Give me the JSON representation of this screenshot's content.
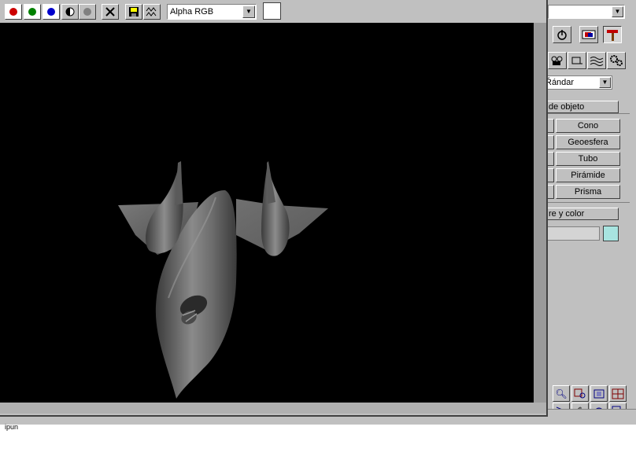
{
  "frame_window": {
    "channel_buttons": [
      {
        "name": "red-channel",
        "color": "#cc0000"
      },
      {
        "name": "green-channel",
        "color": "#008000"
      },
      {
        "name": "blue-channel",
        "color": "#0000cc"
      },
      {
        "name": "alpha-channel",
        "icon": "half-circle-icon"
      },
      {
        "name": "mono-channel",
        "icon": "grey-circle-icon"
      }
    ],
    "clear_icon": "x-icon",
    "save_icon": "floppy-disk-icon",
    "clone_icon": "clone-icon",
    "channel_select": {
      "value": "Alpha RGB"
    },
    "background_color": "#ffffff"
  },
  "command_panel": {
    "subtype_dropdown": "Ŕándar",
    "rollout_object_type": "de objeto",
    "object_buttons": [
      "Cono",
      "Geoesfera",
      "Tubo",
      "Pirámide",
      "Prisma"
    ],
    "rollout_name_color": "re y color",
    "object_color": "#a8e4e0",
    "tab_icons": [
      "hierarchy-icon",
      "motion-icon",
      "display-icon",
      "utilities-icon"
    ],
    "create_icons": [
      "cameras-icon",
      "helpers-icon",
      "spacewarps-icon",
      "systems-icon"
    ],
    "nav_icons": [
      "zoom-icon",
      "zoom-all-icon",
      "zoom-extents-icon",
      "zoom-extents-all-icon",
      "fov-icon",
      "pan-icon",
      "arc-rotate-icon",
      "maximize-icon"
    ]
  },
  "statusbar": {
    "text": "ipun"
  }
}
